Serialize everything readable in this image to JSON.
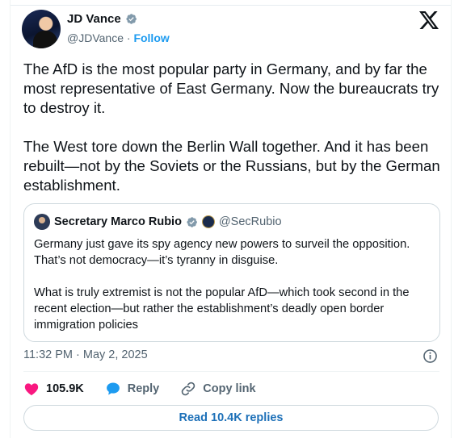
{
  "author": {
    "name": "JD Vance",
    "handle": "@JDVance",
    "separator": "·",
    "follow_label": "Follow"
  },
  "post": {
    "paragraph_1": "The AfD is the most popular party in Germany, and by far the most representative of East Germany. Now the bureaucrats try to destroy it.",
    "paragraph_2": "The West tore down the Berlin Wall together. And it has been rebuilt—not by the Soviets or the Russians, but by the German establishment.",
    "timestamp": "11:32 PM · May 2, 2025"
  },
  "quoted_post": {
    "name": "Secretary Marco Rubio",
    "handle": "@SecRubio",
    "paragraph_1": "Germany just gave its spy agency new powers to surveil the opposition. That’s not democracy—it’s tyranny in disguise.",
    "paragraph_2": "What is truly extremist is not the popular AfD—which took second in the recent election—but rather the establishment’s deadly open border immigration policies"
  },
  "actions": {
    "like_count": "105.9K",
    "reply_label": "Reply",
    "copy_link_label": "Copy link",
    "read_replies_label": "Read 10.4K replies"
  },
  "icons": {
    "verified": "verified-badge-icon",
    "x_logo": "x-logo-icon",
    "info": "info-icon",
    "like": "heart-icon",
    "reply": "speech-bubble-icon",
    "copy_link": "link-icon",
    "seal": "government-seal-icon"
  },
  "colors": {
    "accent": "#1d9bf0",
    "like": "#f91880",
    "text": "#0f1419",
    "muted": "#536471",
    "border": "#cfd9de"
  }
}
